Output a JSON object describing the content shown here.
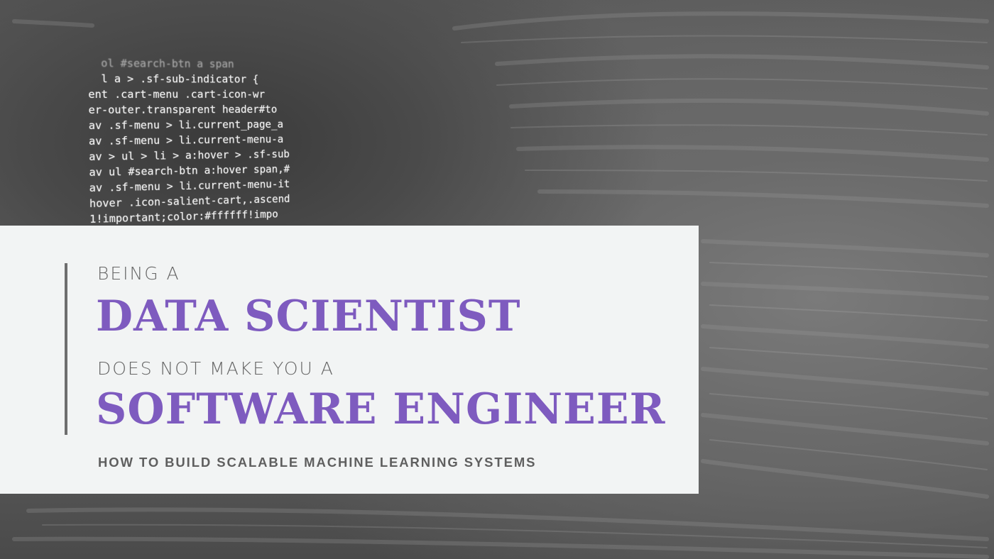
{
  "code_lines": [
    "  ol #search-btn a span",
    "  l a > .sf-sub-indicator {",
    "ent .cart-menu .cart-icon-wr",
    "er-outer.transparent header#to",
    "av .sf-menu > li.current_page_a",
    "av .sf-menu > li.current-menu-a",
    "av > ul > li > a:hover > .sf-sub",
    "av ul #search-btn a:hover span,#",
    "av .sf-menu > li.current-menu-it",
    "hover .icon-salient-cart,.ascend",
    "1!important;color:#ffffff!impo",
    "  ...  .  .  ..  #"
  ],
  "title": {
    "line1": "BEING A",
    "line2": "DATA SCIENTIST",
    "line3": "DOES NOT MAKE YOU A",
    "line4": "SOFTWARE ENGINEER"
  },
  "subtitle": "HOW TO BUILD SCALABLE MACHINE LEARNING SYSTEMS",
  "colors": {
    "accent": "#7e5bbf",
    "card": "#f2f4f4",
    "text": "#666666"
  }
}
